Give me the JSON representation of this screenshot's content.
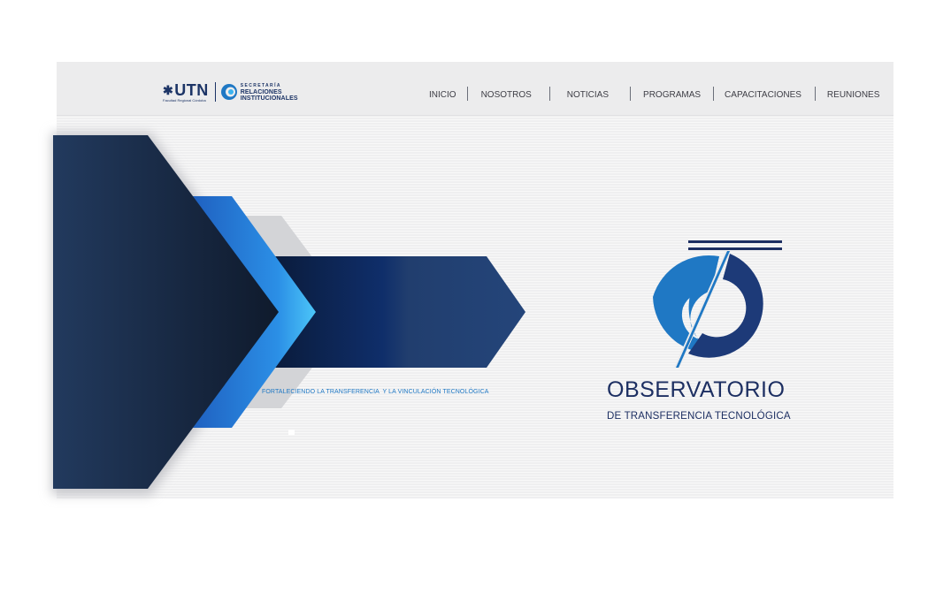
{
  "header": {
    "logo": {
      "utn": "UTN",
      "utn_sub": "Facultad Regional Córdoba",
      "secretaria_line1": "SECRETARÍA",
      "secretaria_line2": "RELACIONES",
      "secretaria_line3": "INSTITUCIONALES"
    },
    "nav": [
      {
        "label": "INICIO"
      },
      {
        "label": "NOSOTROS"
      },
      {
        "label": "NOTICIAS"
      },
      {
        "label": "PROGRAMAS"
      },
      {
        "label": "CAPACITACIONES"
      },
      {
        "label": "REUNIONES"
      }
    ]
  },
  "hero": {
    "tagline": "FORTALECIENDO LA TRANSFERENCIA  Y LA VINCULACIÓN TECNOLÓGICA",
    "title": "OBSERVATORIO",
    "subtitle": "DE TRANSFERENCIA TECNOLÓGICA"
  },
  "colors": {
    "navy": "#1d2f62",
    "blue": "#1f78c4",
    "light_blue": "#3bb3f0",
    "header_bg": "#ececed",
    "hero_bg": "#efeff0"
  },
  "icons": {
    "utn_star": "utn-star-icon",
    "secretaria": "secretaria-swirl-icon",
    "observatorio": "observatorio-circle-logo"
  }
}
